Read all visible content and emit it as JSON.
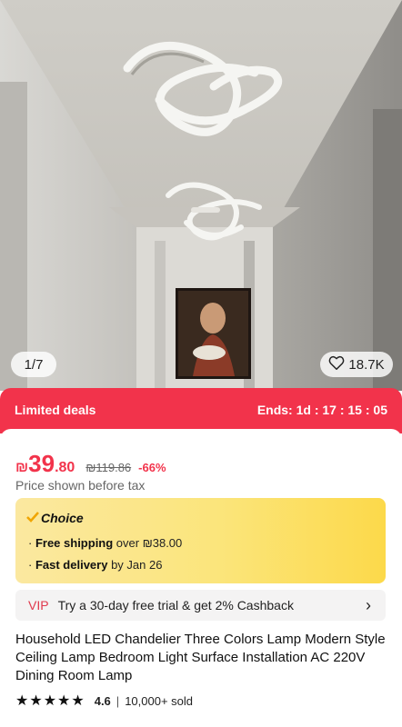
{
  "gallery": {
    "counter": "1/7",
    "likes": "18.7K"
  },
  "deal": {
    "label": "Limited deals",
    "countdown": "Ends: 1d : 17 : 15 : 05"
  },
  "price": {
    "currency": "₪",
    "integer": "39",
    "decimal": ".80",
    "original": "₪119.86",
    "discount": "-66%"
  },
  "tax_note": "Price shown before tax",
  "choice": {
    "label": "Choice",
    "shipping_bold": "Free shipping",
    "shipping_rest": " over ₪38.00",
    "delivery_bold": "Fast delivery",
    "delivery_rest": " by Jan 26"
  },
  "vip": {
    "tag": "VIP",
    "text": "Try a 30-day free trial & get 2% Cashback"
  },
  "product_title": "Household LED Chandelier Three Colors Lamp Modern Style Ceiling Lamp Bedroom Light Surface Installation AC 220V Dining Room Lamp",
  "rating": {
    "stars": 4.6,
    "score": "4.6",
    "sold": "10,000+ sold"
  },
  "colors": {
    "accent": "#f2334b",
    "choice_bg": "#fbe57b"
  }
}
